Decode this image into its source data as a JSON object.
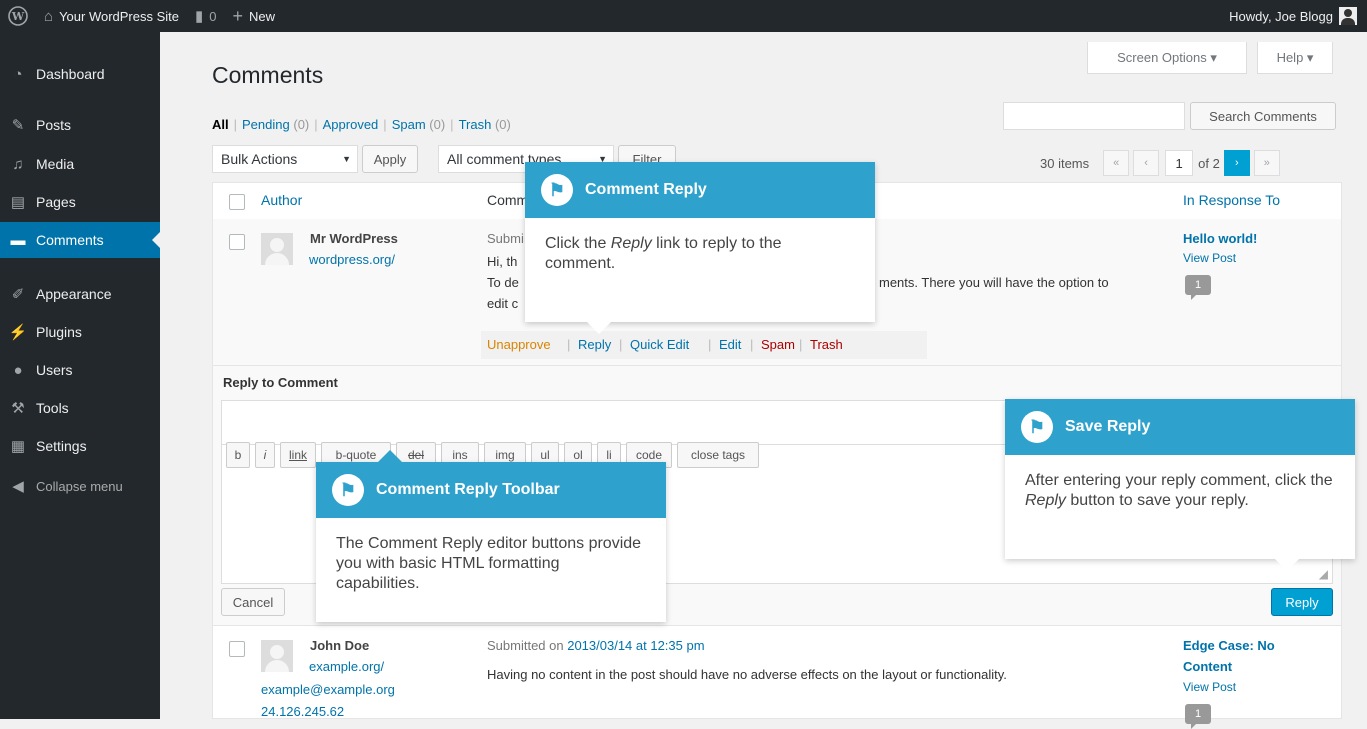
{
  "adminbar": {
    "site_name": "Your WordPress Site",
    "comments_count": "0",
    "new_label": "New",
    "howdy": "Howdy, Joe Blogg"
  },
  "sidebar": {
    "items": [
      {
        "label": "Dashboard",
        "icon": "dashboard-icon"
      },
      {
        "label": "Posts",
        "icon": "pin-icon"
      },
      {
        "label": "Media",
        "icon": "media-icon"
      },
      {
        "label": "Pages",
        "icon": "pages-icon"
      },
      {
        "label": "Comments",
        "icon": "comment-icon"
      },
      {
        "label": "Appearance",
        "icon": "brush-icon"
      },
      {
        "label": "Plugins",
        "icon": "plug-icon"
      },
      {
        "label": "Users",
        "icon": "user-icon"
      },
      {
        "label": "Tools",
        "icon": "wrench-icon"
      },
      {
        "label": "Settings",
        "icon": "settings-icon"
      }
    ],
    "collapse": "Collapse menu"
  },
  "header": {
    "title": "Comments",
    "screen_options": "Screen Options ▾",
    "help": "Help ▾"
  },
  "filters": {
    "all": "All",
    "pending": "Pending",
    "pending_count": "(0)",
    "approved": "Approved",
    "spam": "Spam",
    "spam_count": "(0)",
    "trash": "Trash",
    "trash_count": "(0)"
  },
  "search": {
    "button": "Search Comments"
  },
  "toolbar": {
    "bulk_actions": "Bulk Actions",
    "apply": "Apply",
    "comment_types": "All comment types",
    "filter": "Filter",
    "items": "30 items",
    "page": "1",
    "of": "of 2",
    "first": "«",
    "prev": "‹",
    "next": "›",
    "last": "»"
  },
  "table": {
    "col_author": "Author",
    "col_comment": "Comment",
    "col_response": "In Response To"
  },
  "row1": {
    "author": "Mr WordPress",
    "url": "wordpress.org/",
    "submitted": "Submi",
    "text1": "Hi, th",
    "text2_start": "To de",
    "text2_end": "ments. There you will have the option to",
    "text3": "edit c",
    "actions": {
      "unapprove": "Unapprove",
      "reply": "Reply",
      "quick_edit": "Quick Edit",
      "edit": "Edit",
      "spam": "Spam",
      "trash": "Trash"
    },
    "post": "Hello world!",
    "view": "View Post",
    "count": "1"
  },
  "reply": {
    "heading": "Reply to Comment",
    "buttons": [
      "b",
      "i",
      "link",
      "b-quote",
      "del",
      "ins",
      "img",
      "ul",
      "ol",
      "li",
      "code",
      "close tags"
    ],
    "cancel": "Cancel",
    "reply": "Reply"
  },
  "row2": {
    "author": "John Doe",
    "url": "example.org/",
    "email": "example@example.org",
    "ip": "24.126.245.62",
    "submitted_prefix": "Submitted on ",
    "submitted_link": "2013/03/14 at 12:35 pm",
    "text": "Having no content in the post should have no adverse effects on the layout or functionality.",
    "post_line1": "Edge Case: No",
    "post_line2": "Content",
    "view": "View Post",
    "count": "1"
  },
  "tooltips": {
    "comment_reply": {
      "title": "Comment Reply",
      "body_before": "Click the ",
      "body_em": "Reply",
      "body_after": " link to reply to the comment."
    },
    "toolbar": {
      "title": "Comment Reply Toolbar",
      "body": "The Comment Reply editor buttons provide you with basic HTML formatting capabilities."
    },
    "save": {
      "title": "Save Reply",
      "body_before": "After entering your reply comment, click the ",
      "body_em": "Reply",
      "body_after": " button to save your reply."
    }
  },
  "colors": {
    "accent": "#0073aa",
    "tooltip": "#2ea2cc",
    "admin_bg": "#23282d"
  }
}
